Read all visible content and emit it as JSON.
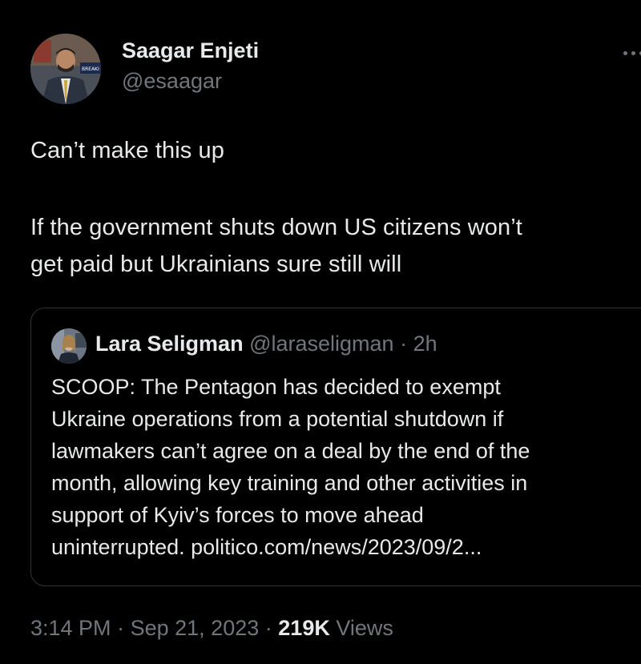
{
  "author": {
    "name": "Saagar Enjeti",
    "handle": "@esaagar",
    "avatar_overlay_text": "BREAKI"
  },
  "tweet": {
    "lines": [
      "Can’t make this up",
      "If the government shuts down US citizens won’t",
      "get paid but Ukrainians sure still will"
    ]
  },
  "quoted_tweet": {
    "name": "Lara Seligman",
    "handle": "@laraseligman",
    "separator": "·",
    "time": "2h",
    "lines": [
      "SCOOP: The Pentagon has decided to exempt",
      "Ukraine operations from a potential shutdown if",
      "lawmakers can’t agree on a deal by the end of the",
      "month, allowing key training and other activities in",
      "support of Kyiv’s forces to move ahead",
      "uninterrupted. politico.com/news/2023/09/2..."
    ]
  },
  "footer": {
    "time": "3:14 PM",
    "separator": "·",
    "date": "Sep 21, 2023",
    "views_count": "219K",
    "views_label": "Views"
  },
  "icons": {
    "more": "more-options-icon"
  },
  "colors": {
    "background": "#000000",
    "primary_text": "#e7e9ea",
    "secondary_text": "#71767b",
    "card_border": "#2f3336"
  }
}
